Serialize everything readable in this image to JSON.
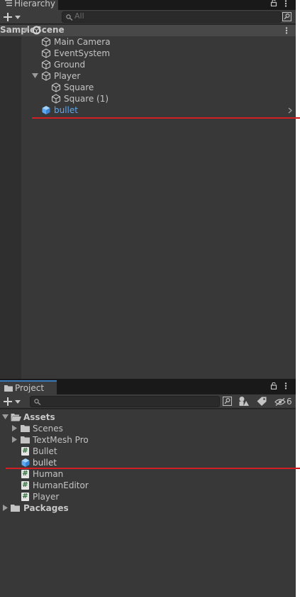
{
  "hierarchy": {
    "tab_label": "Hierarchy",
    "search_placeholder": "All",
    "scene": "SampleScene",
    "items": [
      {
        "label": "Main Camera"
      },
      {
        "label": "EventSystem"
      },
      {
        "label": "Ground"
      },
      {
        "label": "Player"
      },
      {
        "label": "Square"
      },
      {
        "label": "Square (1)"
      },
      {
        "label": "bullet"
      }
    ]
  },
  "project": {
    "tab_label": "Project",
    "hidden_count": "6",
    "assets": "Assets",
    "items": [
      {
        "label": "Scenes"
      },
      {
        "label": "TextMesh Pro"
      },
      {
        "label": "Bullet"
      },
      {
        "label": "bullet"
      },
      {
        "label": "Human"
      },
      {
        "label": "HumanEditor"
      },
      {
        "label": "Player"
      }
    ],
    "packages": "Packages"
  },
  "colors": {
    "selection_accent": "#3a79bb",
    "prefab_blue": "#5ba8f5",
    "annotation_red": "#d21f24"
  }
}
